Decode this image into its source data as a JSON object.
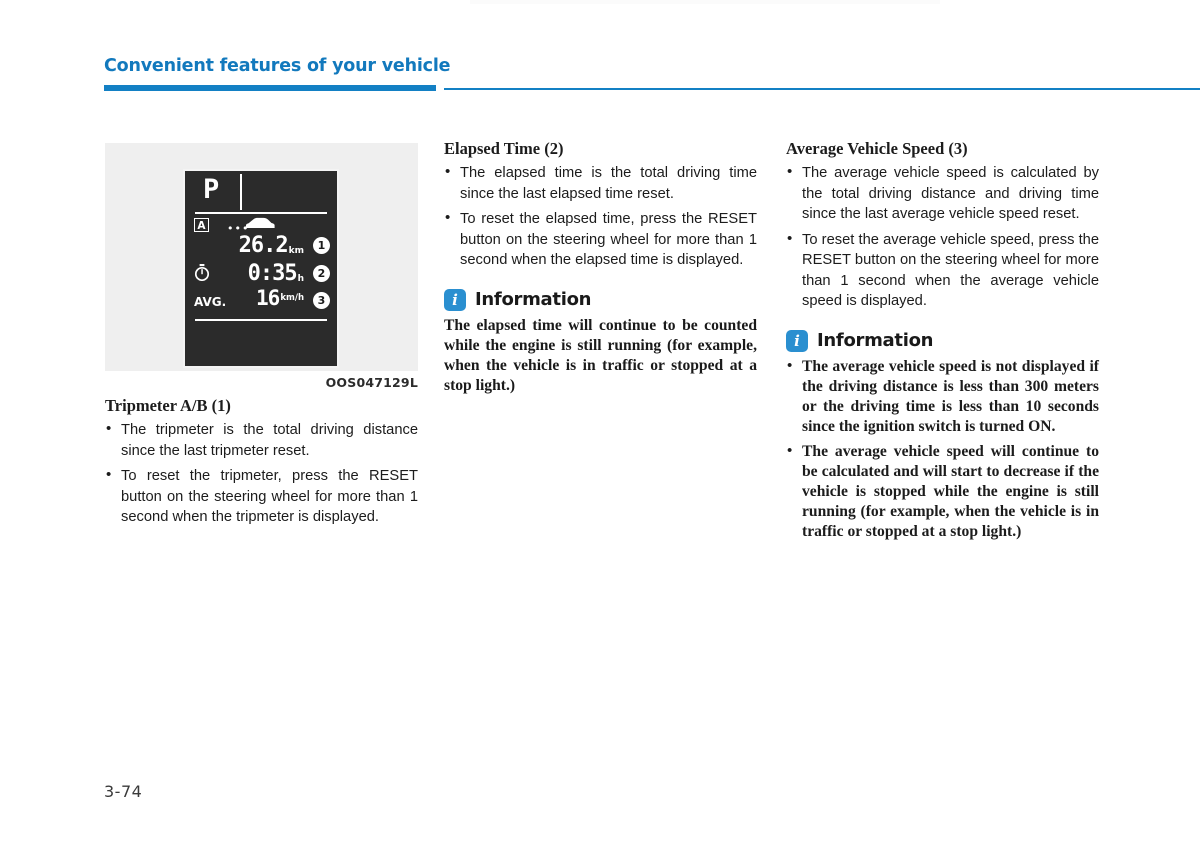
{
  "header": {
    "title": "Convenient features of your vehicle",
    "accent_color": "#1380c4"
  },
  "figure": {
    "caption": "OOS047129L",
    "display": {
      "gear": "P",
      "trip_badge": "A",
      "dots": "•••",
      "car_icon": "car-icon",
      "distance_value": "26.2",
      "distance_unit": "km",
      "time_icon": "stopwatch-icon",
      "time_value": "0:35",
      "time_unit": "h",
      "avg_label": "AVG.",
      "speed_value": "16",
      "speed_unit": "km/h",
      "callouts": [
        "1",
        "2",
        "3"
      ]
    }
  },
  "left_column": {
    "subhead": "Tripmeter A/B (1)",
    "bullets": [
      "The tripmeter is the total driving distance since the last tripmeter reset.",
      "To reset the tripmeter, press the RESET button on the steering wheel for more than 1 second when the tripmeter is displayed."
    ]
  },
  "middle_column": {
    "subhead": "Elapsed Time (2)",
    "bullets": [
      "The elapsed time is the total driving time since the last elapsed time reset.",
      "To reset the elapsed time, press the RESET button on the steering wheel for more than 1 second when the elapsed time is displayed."
    ],
    "information": {
      "icon": "info-icon",
      "title": "Information",
      "body": "The elapsed time will continue to be counted while the engine is still running (for example, when the vehicle is in traffic or stopped at a stop light.)"
    }
  },
  "right_column": {
    "subhead": "Average Vehicle Speed (3)",
    "bullets": [
      "The average vehicle speed is calculated by the total driving distance and driving time since the last average vehicle speed reset.",
      "To reset the average vehicle speed, press the RESET button on the steering wheel for more than 1 second when the average vehicle speed is displayed."
    ],
    "information": {
      "icon": "info-icon",
      "title": "Information",
      "bullets": [
        "The average vehicle speed is not displayed if the driving distance is less than 300 meters or the driving time is less than 10 seconds since the ignition switch is turned ON.",
        "The average vehicle speed will continue to be calculated and will start to decrease if the vehicle is stopped while the engine is still running (for example, when the vehicle is in traffic or stopped at a stop light.)"
      ]
    }
  },
  "footer": {
    "page_number": "3-74"
  }
}
